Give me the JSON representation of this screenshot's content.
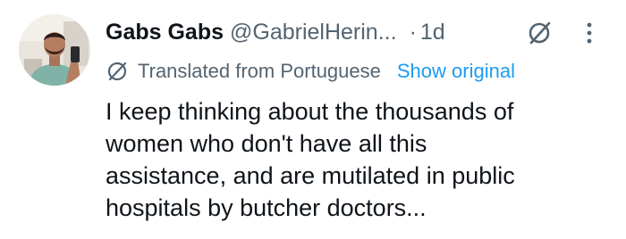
{
  "author": {
    "display_name": "Gabs Gabs",
    "handle": "@GabrielHerin...",
    "avatar_icon": "profile-photo"
  },
  "meta": {
    "separator": "·",
    "time": "1d"
  },
  "actions": {
    "grok_icon": "slash-circle-icon",
    "more_icon": "more-vertical-icon"
  },
  "translation": {
    "icon": "slash-circle-icon",
    "label": "Translated from Portuguese",
    "show_original": "Show original"
  },
  "tweet": {
    "lines": [
      "I keep thinking about the thousands of",
      "women who don't have all this",
      "assistance, and are mutilated in public",
      "hospitals by butcher doctors..."
    ]
  },
  "colors": {
    "text": "#0f1419",
    "secondary": "#536471",
    "link": "#1d9bf0"
  }
}
